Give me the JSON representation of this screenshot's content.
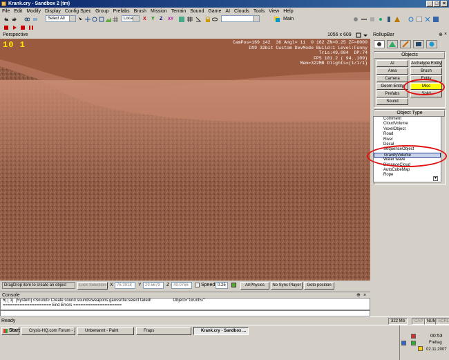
{
  "window": {
    "title": "Krank.cry - Sandbox 2 (tm)"
  },
  "menu": [
    "File",
    "Edit",
    "Modify",
    "Display",
    "Config Spec",
    "Group",
    "Prefabs",
    "Brush",
    "Mission",
    "Terrain",
    "Sound",
    "Game",
    "AI",
    "Clouds",
    "Tools",
    "View",
    "Help"
  ],
  "toolbar": {
    "select_filter": "Select All",
    "coord_system": "Local",
    "axis_labels": [
      "X",
      "Y",
      "Z",
      "XY"
    ],
    "layer_label": "Main"
  },
  "viewport": {
    "name": "Perspective",
    "resolution": "1056 x 609",
    "fps_badge": "10 1",
    "hud": [
      "CamPos=169 142  36 Angl= 11  0 162 ZN=0.25 ZF=8000",
      "DX9 32bit Custom DevMode Build:1 Level:Funny",
      "Tris:49,084  DP:74",
      "FPS 101.2 ( 94..109)",
      "Mem=322MB Dlights=(1/1/1)"
    ]
  },
  "status_row": {
    "hint": "DragDrop item to create an object",
    "lock_selection": "Lock Selection",
    "x_label": "X",
    "x_value": "76.3918",
    "y_label": "Y",
    "y_value": "29.5679",
    "z_label": "Z",
    "z_value": "49.0756",
    "speed_label": "Speed:",
    "speed_value": "0.25",
    "ai_physics": "AI/Physics",
    "no_sync_player": "No Sync Player",
    "goto_position": "Goto position"
  },
  "console": {
    "title": "Console",
    "lines": [
      "6) [ 1]  [System] <Sound> Create sound sounds/weapons:gaussrifle:select failed!                   Object=\"Grunt57\"",
      "==================== End Errors ===================="
    ]
  },
  "statusbar": {
    "status": "Ready",
    "memory": "322 Mb",
    "caps": "CAP",
    "num": "NUM",
    "scrl": "SCRL"
  },
  "rollup": {
    "title": "RollupBar",
    "objects_title": "Objects",
    "buttons": [
      [
        "AI",
        "Archetype Entity"
      ],
      [
        "Area",
        "Brush"
      ],
      [
        "Camera",
        "Entity"
      ],
      [
        "Geom Entity",
        "Misc"
      ],
      [
        "Prefabs",
        "Solid"
      ],
      [
        "Sound",
        ""
      ]
    ],
    "selected_button": "Misc",
    "object_type_title": "Object Type",
    "object_types": [
      "Comment",
      "CloudVolume",
      "VoxelObject",
      "Road",
      "River",
      "Decal",
      "SequenceObject",
      "GravityVolume",
      "Water wave",
      "DistanceCloud",
      "AutoCubeMap",
      "Rope"
    ],
    "selected_type": "GravityVolume"
  },
  "taskbar": {
    "start": "Start",
    "tasks": [
      "Crysis-HQ.com Forum - ...",
      "Unbenannt - Paint",
      "Fraps",
      "Krank.cry - Sandbox ..."
    ],
    "active_task": "Krank.cry - Sandbox ...",
    "clock": "00:53",
    "day": "Freitag",
    "date": "02.11.2007"
  }
}
